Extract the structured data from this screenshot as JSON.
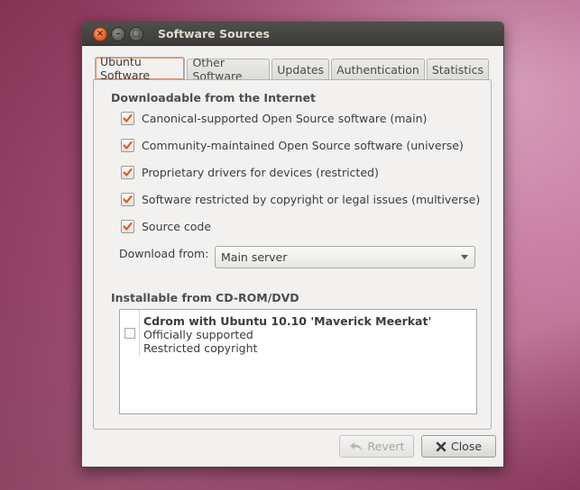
{
  "window": {
    "title": "Software Sources"
  },
  "tabs": [
    {
      "label": "Ubuntu Software",
      "active": true
    },
    {
      "label": "Other Software",
      "active": false
    },
    {
      "label": "Updates",
      "active": false
    },
    {
      "label": "Authentication",
      "active": false
    },
    {
      "label": "Statistics",
      "active": false
    }
  ],
  "internet": {
    "heading": "Downloadable from the Internet",
    "options": [
      {
        "label": "Canonical-supported Open Source software (main)",
        "checked": true
      },
      {
        "label": "Community-maintained Open Source software (universe)",
        "checked": true
      },
      {
        "label": "Proprietary drivers for devices (restricted)",
        "checked": true
      },
      {
        "label": "Software restricted by copyright or legal issues (multiverse)",
        "checked": true
      },
      {
        "label": "Source code",
        "checked": true
      }
    ],
    "download_from_label": "Download from:",
    "download_from_value": "Main server"
  },
  "cdrom": {
    "heading": "Installable from CD-ROM/DVD",
    "items": [
      {
        "name": "Cdrom with Ubuntu 10.10 'Maverick Meerkat'",
        "line2": "Officially supported",
        "line3": "Restricted copyright",
        "checked": false
      }
    ]
  },
  "buttons": {
    "revert": "Revert",
    "close": "Close"
  },
  "colors": {
    "accent": "#e25a1c",
    "titlebar": "#3c3b37",
    "window_bg": "#f2f1f0"
  }
}
